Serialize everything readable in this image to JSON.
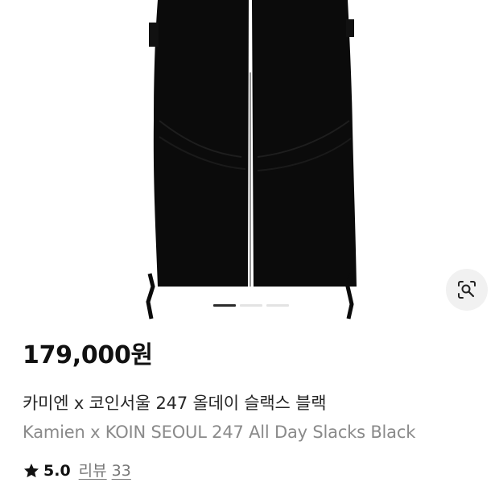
{
  "product": {
    "price": "179,000원",
    "title_ko": "카미엔 x 코인서울 247 올데이 슬랙스 블랙",
    "title_en": "Kamien x KOIN SEOUL 247 All Day Slacks Black",
    "rating": "5.0",
    "reviews_label": "리뷰",
    "reviews_count": "33"
  },
  "gallery": {
    "image_subject": "black-wide-slacks-image",
    "page_count": 3,
    "current_page": 1
  },
  "icons": {
    "lens": "visual-search-icon",
    "star": "star-icon"
  },
  "colors": {
    "garment": "#0b0b0b",
    "indicator_active": "#2b2b2b",
    "indicator_inactive": "#e3e3e3",
    "secondary_text": "#8a8a8a"
  }
}
